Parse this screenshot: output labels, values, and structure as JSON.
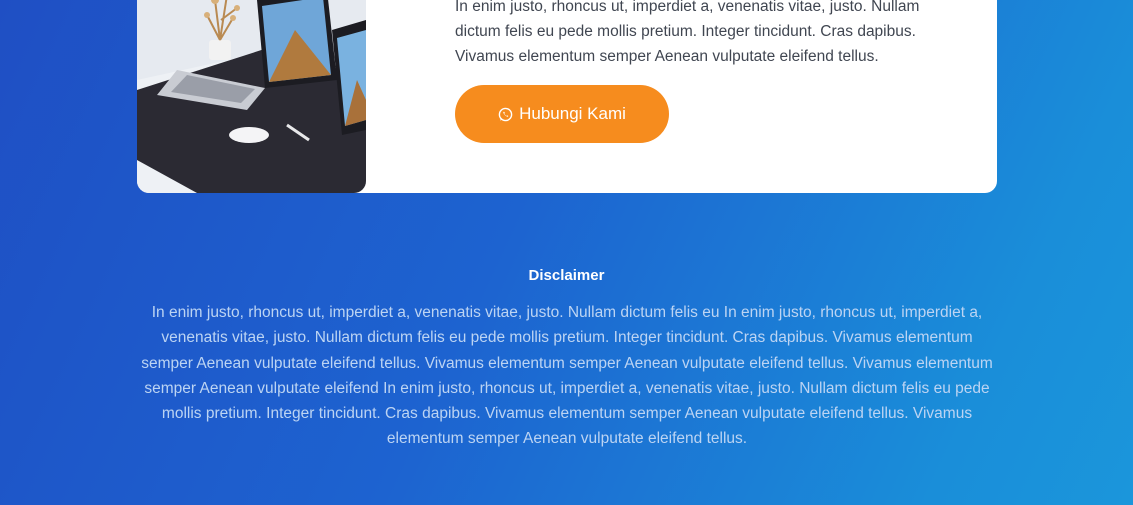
{
  "card": {
    "text": "In enim justo, rhoncus ut, imperdiet a, venenatis vitae, justo. Nullam dictum felis eu pede mollis pretium. Integer tincidunt. Cras dapibus. Vivamus elementum semper Aenean vulputate eleifend tellus.",
    "image_icon": "laptop-desk-photo",
    "button_label": "Hubungi Kami",
    "button_icon": "whatsapp-icon",
    "button_color": "#f68c1e"
  },
  "disclaimer": {
    "title": "Disclaimer",
    "text": "In enim justo, rhoncus ut, imperdiet a, venenatis vitae, justo. Nullam dictum felis eu In enim justo, rhoncus ut, imperdiet a, venenatis vitae, justo. Nullam dictum felis eu pede mollis pretium. Integer tincidunt. Cras dapibus. Vivamus elementum semper Aenean vulputate eleifend tellus. Vivamus elementum semper Aenean vulputate eleifend tellus. Vivamus elementum semper Aenean vulputate eleifend In enim justo, rhoncus ut, imperdiet a, venenatis vitae, justo. Nullam dictum felis eu pede mollis pretium. Integer tincidunt. Cras dapibus. Vivamus elementum semper Aenean vulputate eleifend tellus. Vivamus elementum semper Aenean vulputate eleifend tellus."
  },
  "colors": {
    "background_start": "#1f4fc4",
    "background_end": "#1b96db",
    "disclaimer_text": "#bcd4f3"
  }
}
